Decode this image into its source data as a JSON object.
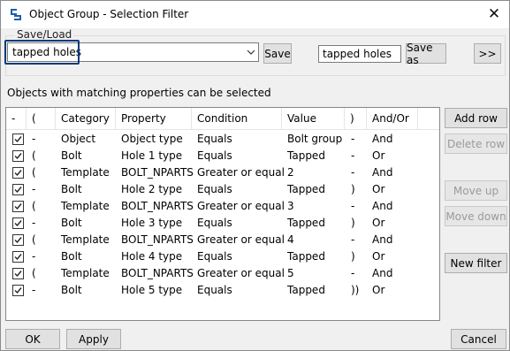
{
  "window": {
    "title": "Object Group - Selection Filter",
    "close_glyph": "✕"
  },
  "saveload": {
    "group_label": "Save/Load",
    "selected": "tapped holes",
    "save_label": "Save",
    "save_as_value": "tapped holes",
    "save_as_label": "Save as",
    "more_label": ">>"
  },
  "info_text": "Objects with matching properties can be selected",
  "table": {
    "columns": [
      "-",
      "(",
      "Category",
      "Property",
      "Condition",
      "Value",
      ")",
      "And/Or"
    ],
    "rows": [
      {
        "checked": true,
        "dash": "-",
        "open": "-",
        "category": "Object",
        "property": "Object type",
        "condition": "Equals",
        "value": "Bolt group",
        "close": "-",
        "andor": "And"
      },
      {
        "checked": true,
        "dash": "-",
        "open": "(",
        "category": "Bolt",
        "property": "Hole 1 type",
        "condition": "Equals",
        "value": "Tapped",
        "close": "-",
        "andor": "Or"
      },
      {
        "checked": true,
        "dash": "-",
        "open": "(",
        "category": "Template",
        "property": "BOLT_NPARTS",
        "condition": "Greater or equal",
        "value": "2",
        "close": "-",
        "andor": "And"
      },
      {
        "checked": true,
        "dash": "-",
        "open": "-",
        "category": "Bolt",
        "property": "Hole 2 type",
        "condition": "Equals",
        "value": "Tapped",
        "close": ")",
        "andor": "Or"
      },
      {
        "checked": true,
        "dash": "-",
        "open": "(",
        "category": "Template",
        "property": "BOLT_NPARTS",
        "condition": "Greater or equal",
        "value": "3",
        "close": "-",
        "andor": "And"
      },
      {
        "checked": true,
        "dash": "-",
        "open": "-",
        "category": "Bolt",
        "property": "Hole 3 type",
        "condition": "Equals",
        "value": "Tapped",
        "close": ")",
        "andor": "Or"
      },
      {
        "checked": true,
        "dash": "-",
        "open": "(",
        "category": "Template",
        "property": "BOLT_NPARTS",
        "condition": "Greater or equal",
        "value": "4",
        "close": "-",
        "andor": "And"
      },
      {
        "checked": true,
        "dash": "-",
        "open": "-",
        "category": "Bolt",
        "property": "Hole 4 type",
        "condition": "Equals",
        "value": "Tapped",
        "close": ")",
        "andor": "Or"
      },
      {
        "checked": true,
        "dash": "-",
        "open": "(",
        "category": "Template",
        "property": "BOLT_NPARTS",
        "condition": "Greater or equal",
        "value": "5",
        "close": "-",
        "andor": "And"
      },
      {
        "checked": true,
        "dash": "-",
        "open": "-",
        "category": "Bolt",
        "property": "Hole 5 type",
        "condition": "Equals",
        "value": "Tapped",
        "close": "))",
        "andor": "Or"
      }
    ]
  },
  "side_buttons": {
    "add_row": "Add row",
    "delete_row": "Delete row",
    "move_up": "Move up",
    "move_down": "Move down",
    "new_filter": "New filter"
  },
  "footer": {
    "ok": "OK",
    "apply": "Apply",
    "cancel": "Cancel"
  }
}
